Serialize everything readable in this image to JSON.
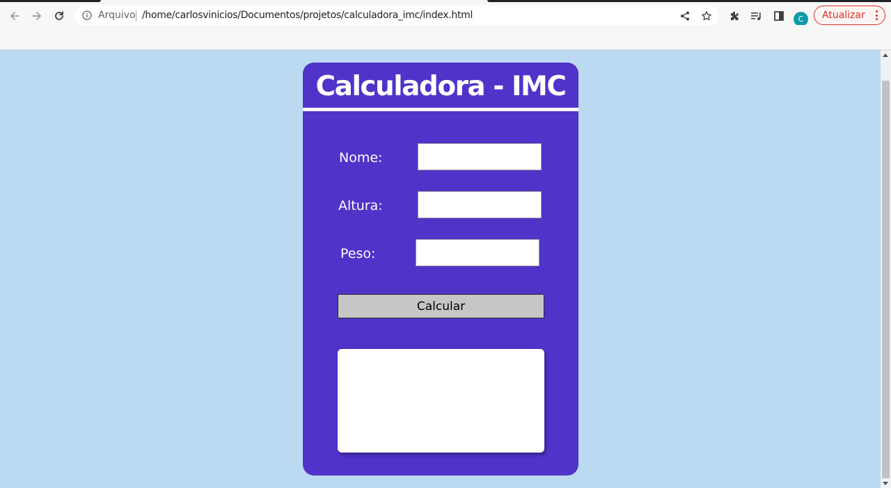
{
  "browser": {
    "origin_label": "Arquivo",
    "url": "/home/carlosvinicios/Documentos/projetos/calculadora_imc/index.html",
    "profile_initial": "C",
    "update_label": "Atualizar"
  },
  "colors": {
    "page_bg": "#bbd9f0",
    "card_bg": "#5033c8",
    "button_bg": "#c6c6c6",
    "update_accent": "#d93025",
    "avatar_bg": "#0e9ba7"
  },
  "icons": [
    "back-arrow-icon",
    "forward-arrow-icon",
    "reload-icon",
    "info-icon",
    "share-icon",
    "star-icon",
    "extensions-icon",
    "media-queue-icon",
    "side-panel-icon",
    "menu-dots-icon"
  ],
  "calculator": {
    "title": "Calculadora - IMC",
    "fields": [
      {
        "label": "Nome:",
        "value": "",
        "placeholder": ""
      },
      {
        "label": "Altura:",
        "value": "",
        "placeholder": ""
      },
      {
        "label": "Peso:",
        "value": "",
        "placeholder": ""
      }
    ],
    "button_label": "Calcular",
    "result": ""
  }
}
